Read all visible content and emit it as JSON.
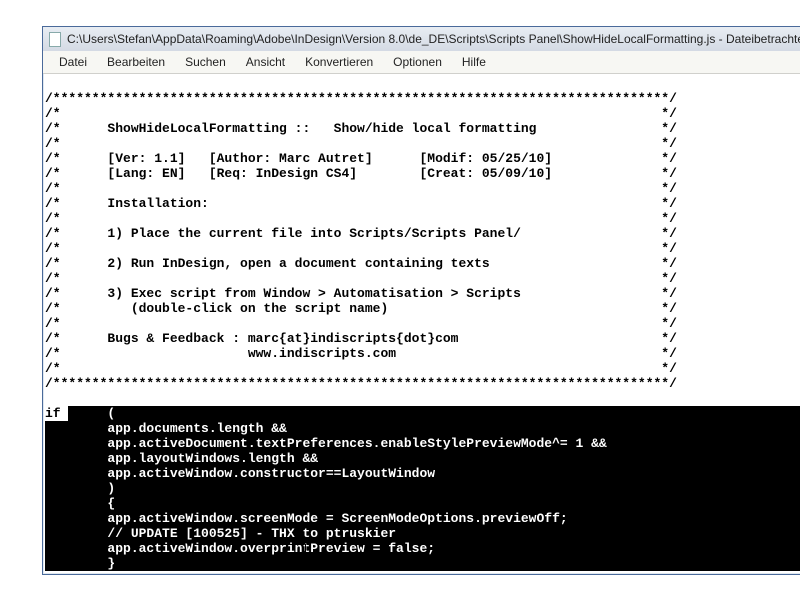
{
  "title": "C:\\Users\\Stefan\\AppData\\Roaming\\Adobe\\InDesign\\Version 8.0\\de_DE\\Scripts\\Scripts Panel\\ShowHideLocalFormatting.js - Dateibetrachte",
  "menu": {
    "datei": "Datei",
    "bearbeiten": "Bearbeiten",
    "suchen": "Suchen",
    "ansicht": "Ansicht",
    "konvertieren": "Konvertieren",
    "optionen": "Optionen",
    "hilfe": "Hilfe"
  },
  "code": {
    "c01": "/*******************************************************************************/",
    "c02": "/*                                                                             */",
    "c03": "/*      ShowHideLocalFormatting ::   Show/hide local formatting                */",
    "c04": "/*                                                                             */",
    "c05": "/*      [Ver: 1.1]   [Author: Marc Autret]      [Modif: 05/25/10]              */",
    "c06": "/*      [Lang: EN]   [Req: InDesign CS4]        [Creat: 05/09/10]              */",
    "c07": "/*                                                                             */",
    "c08": "/*      Installation:                                                          */",
    "c09": "/*                                                                             */",
    "c10": "/*      1) Place the current file into Scripts/Scripts Panel/                  */",
    "c11": "/*                                                                             */",
    "c12": "/*      2) Run InDesign, open a document containing texts                      */",
    "c13": "/*                                                                             */",
    "c14": "/*      3) Exec script from Window > Automatisation > Scripts                  */",
    "c15": "/*         (double-click on the script name)                                   */",
    "c16": "/*                                                                             */",
    "c17": "/*      Bugs & Feedback : marc{at}indiscripts{dot}com                          */",
    "c18": "/*                        www.indiscripts.com                                  */",
    "c19": "/*                                                                             */",
    "c20": "/*******************************************************************************/",
    "c21_blank": " ",
    "sel_if": "if ",
    "s01": "     (",
    "s02": "        app.documents.length &&",
    "s03": "        app.activeDocument.textPreferences.enableStylePreviewMode^= 1 &&",
    "s04": "        app.layoutWindows.length &&",
    "s05": "        app.activeWindow.constructor==LayoutWindow",
    "s06": "        )",
    "s07": "        {",
    "s08": "        app.activeWindow.screenMode = ScreenModeOptions.previewOff;",
    "s09": "        // UPDATE [100525] - THX to ptruskier",
    "s10": "        app.activeWindow.overprintPreview = false;",
    "s11": "        }"
  }
}
